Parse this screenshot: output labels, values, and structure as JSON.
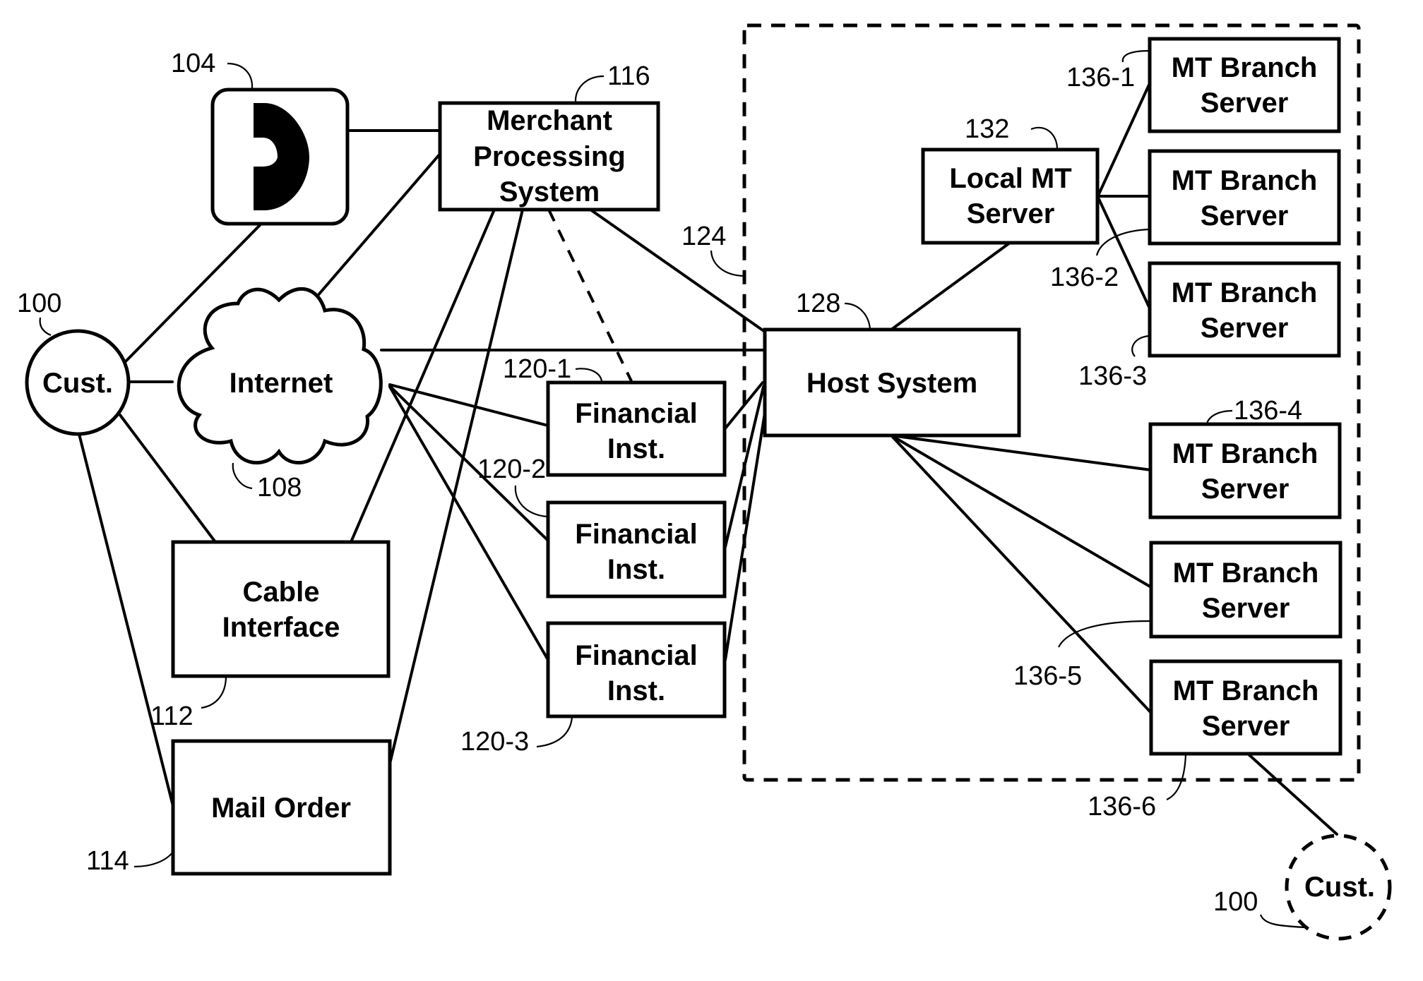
{
  "figure": {
    "description": "Network block diagram of customer payment channels, merchant processing, financial institutions, host system and money transfer servers"
  },
  "nodes": {
    "customer_main": {
      "label": "Cust.",
      "ref": "100"
    },
    "telephone": {
      "label": "",
      "ref": "104",
      "icon": "telephone-handset-icon"
    },
    "internet": {
      "label": "Internet",
      "ref": "108"
    },
    "cable": {
      "label_lines": [
        "Cable",
        "Interface"
      ],
      "ref": "112"
    },
    "mail_order": {
      "label": "Mail Order",
      "ref": "114"
    },
    "merchant": {
      "label_lines": [
        "Merchant",
        "Processing",
        "System"
      ],
      "ref": "116"
    },
    "financial": [
      {
        "label_lines": [
          "Financial",
          "Inst."
        ],
        "ref": "120-1"
      },
      {
        "label_lines": [
          "Financial",
          "Inst."
        ],
        "ref": "120-2"
      },
      {
        "label_lines": [
          "Financial",
          "Inst."
        ],
        "ref": "120-3"
      }
    ],
    "enclosure": {
      "ref": "124"
    },
    "host": {
      "label": "Host System",
      "ref": "128"
    },
    "local_mt": {
      "label_lines": [
        "Local MT",
        "Server"
      ],
      "ref": "132"
    },
    "branches": [
      {
        "label_lines": [
          "MT Branch",
          "Server"
        ],
        "ref": "136-1"
      },
      {
        "label_lines": [
          "MT Branch",
          "Server"
        ],
        "ref": "136-2"
      },
      {
        "label_lines": [
          "MT Branch",
          "Server"
        ],
        "ref": "136-3"
      },
      {
        "label_lines": [
          "MT Branch",
          "Server"
        ],
        "ref": "136-4"
      },
      {
        "label_lines": [
          "MT Branch",
          "Server"
        ],
        "ref": "136-5"
      },
      {
        "label_lines": [
          "MT Branch",
          "Server"
        ],
        "ref": "136-6"
      }
    ],
    "customer_remote": {
      "label": "Cust.",
      "ref": "100"
    }
  },
  "connections": [
    {
      "from": "customer_main",
      "to": "telephone"
    },
    {
      "from": "customer_main",
      "to": "internet"
    },
    {
      "from": "customer_main",
      "to": "cable"
    },
    {
      "from": "customer_main",
      "to": "mail_order"
    },
    {
      "from": "telephone",
      "to": "merchant"
    },
    {
      "from": "internet",
      "to": "merchant"
    },
    {
      "from": "cable",
      "to": "merchant"
    },
    {
      "from": "mail_order",
      "to": "merchant"
    },
    {
      "from": "internet",
      "to": "host"
    },
    {
      "from": "internet",
      "to": "financial-1"
    },
    {
      "from": "internet",
      "to": "financial-2"
    },
    {
      "from": "internet",
      "to": "financial-3"
    },
    {
      "from": "merchant",
      "to": "financial-1",
      "style": "dashed"
    },
    {
      "from": "merchant",
      "to": "host"
    },
    {
      "from": "financial-1",
      "to": "host"
    },
    {
      "from": "financial-2",
      "to": "host"
    },
    {
      "from": "financial-3",
      "to": "host"
    },
    {
      "from": "host",
      "to": "local_mt"
    },
    {
      "from": "local_mt",
      "to": "branch-1"
    },
    {
      "from": "local_mt",
      "to": "branch-2"
    },
    {
      "from": "local_mt",
      "to": "branch-3"
    },
    {
      "from": "host",
      "to": "branch-4"
    },
    {
      "from": "host",
      "to": "branch-5"
    },
    {
      "from": "host",
      "to": "branch-6"
    },
    {
      "from": "branch-6",
      "to": "customer_remote"
    }
  ]
}
